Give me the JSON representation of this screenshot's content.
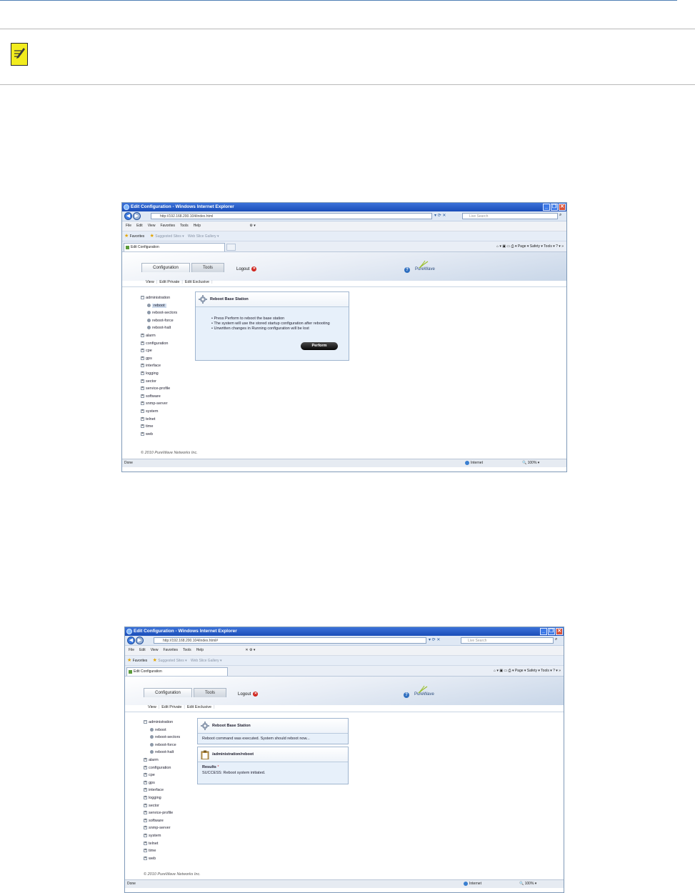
{
  "screen1": {
    "window_title": "Edit Configuration - Windows Internet Explorer",
    "address": "http://192.168.200.104/index.html",
    "search_placeholder": "Live Search",
    "menu": [
      "File",
      "Edit",
      "View",
      "Favorites",
      "Tools",
      "Help"
    ],
    "favorites": {
      "label": "Favorites",
      "suggested": "Suggested Sites ▾",
      "gallery": "Web Slice Gallery ▾"
    },
    "tab_title": "Edit Configuration",
    "cmdbar": "⌂ ▾  ▣  ▭ ⎙ ▾  Page ▾  Safety ▾  Tools ▾  ? ▾  »",
    "tabs": {
      "configuration": "Configuration",
      "tools": "Tools"
    },
    "logout": "Logout",
    "logo": "PureWave",
    "subnav": [
      "View",
      "Edit Private",
      "Edit Exclusive"
    ],
    "tree": {
      "root": "administration",
      "children": [
        "reboot",
        "reboot-sectors",
        "reboot-force",
        "reboot-halt"
      ],
      "others": [
        "alarm",
        "configuration",
        "cpe",
        "gps",
        "interface",
        "logging",
        "sector",
        "service-profile",
        "software",
        "snmp-server",
        "system",
        "telnet",
        "time",
        "web"
      ]
    },
    "panel_title": "Reboot Base Station",
    "bullets": [
      "Press Perform to reboot the base station",
      "The system will use the stored startup configuration after rebooting",
      "Unwritten changes in Running configuration will be lost"
    ],
    "perform": "Perform",
    "copyright": "© 2010 PureWave Networks Inc.",
    "status": {
      "left": "Done",
      "zone": "Internet",
      "zoom": "🔍 100% ▾"
    }
  },
  "screen2": {
    "window_title": "Edit Configuration - Windows Internet Explorer",
    "address": "http://192.168.200.104/index.html#",
    "search_placeholder": "Live Search",
    "menu": [
      "File",
      "Edit",
      "View",
      "Favorites",
      "Tools",
      "Help"
    ],
    "favorites": {
      "label": "Favorites",
      "suggested": "Suggested Sites ▾",
      "gallery": "Web Slice Gallery ▾"
    },
    "tab_title": "Edit Configuration",
    "cmdbar": "⌂ ▾  ▣  ▭ ⎙ ▾  Page ▾  Safety ▾  Tools ▾  ? ▾  »",
    "tabs": {
      "configuration": "Configuration",
      "tools": "Tools"
    },
    "logout": "Logout",
    "logo": "PureWave",
    "subnav": [
      "View",
      "Edit Private",
      "Edit Exclusive"
    ],
    "tree": {
      "root": "administration",
      "children": [
        "reboot",
        "reboot-sectors",
        "reboot-force",
        "reboot-halt"
      ],
      "others": [
        "alarm",
        "configuration",
        "cpe",
        "gps",
        "interface",
        "logging",
        "sector",
        "service-profile",
        "software",
        "snmp-server",
        "system",
        "telnet",
        "time",
        "web"
      ]
    },
    "panel_title": "Reboot Base Station",
    "panel_msg": "Reboot command was executed. System should reboot now...",
    "result_title": "/administration/reboot",
    "results_label": "Results",
    "results_text": "SUCCESS: Reboot system initiated.",
    "copyright": "© 2010 PureWave Networks Inc.",
    "status": {
      "left": "Done",
      "zone": "Internet",
      "zoom": "🔍 100% ▾"
    }
  }
}
